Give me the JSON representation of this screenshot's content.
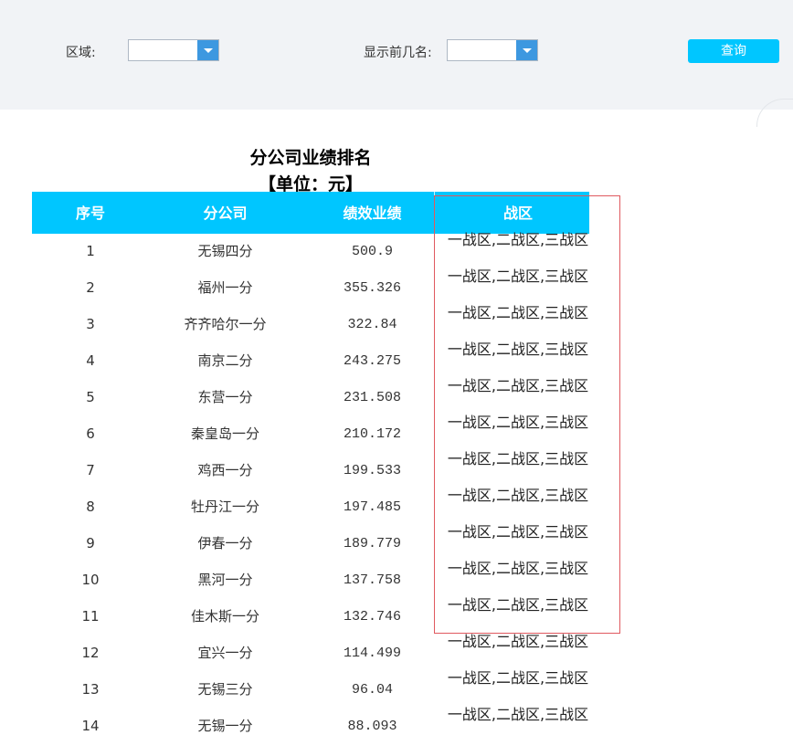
{
  "filters": {
    "region_label": "区域:",
    "region_value": "",
    "topn_label": "显示前几名:",
    "topn_value": "",
    "query_label": "查询"
  },
  "report": {
    "title": "分公司业绩排名",
    "unit": "【单位：元】",
    "columns": [
      "序号",
      "分公司",
      "绩效业绩",
      "战区"
    ],
    "rows": [
      {
        "idx": "1",
        "name": "无锡四分",
        "perf": "500.9",
        "zone": "一战区,二战区,三战区"
      },
      {
        "idx": "2",
        "name": "福州一分",
        "perf": "355.326",
        "zone": "一战区,二战区,三战区"
      },
      {
        "idx": "3",
        "name": "齐齐哈尔一分",
        "perf": "322.84",
        "zone": "一战区,二战区,三战区"
      },
      {
        "idx": "4",
        "name": "南京二分",
        "perf": "243.275",
        "zone": "一战区,二战区,三战区"
      },
      {
        "idx": "5",
        "name": "东营一分",
        "perf": "231.508",
        "zone": "一战区,二战区,三战区"
      },
      {
        "idx": "6",
        "name": "秦皇岛一分",
        "perf": "210.172",
        "zone": "一战区,二战区,三战区"
      },
      {
        "idx": "7",
        "name": "鸡西一分",
        "perf": "199.533",
        "zone": "一战区,二战区,三战区"
      },
      {
        "idx": "8",
        "name": "牡丹江一分",
        "perf": "197.485",
        "zone": "一战区,二战区,三战区"
      },
      {
        "idx": "9",
        "name": "伊春一分",
        "perf": "189.779",
        "zone": "一战区,二战区,三战区"
      },
      {
        "idx": "10",
        "name": "黑河一分",
        "perf": "137.758",
        "zone": "一战区,二战区,三战区"
      },
      {
        "idx": "11",
        "name": "佳木斯一分",
        "perf": "132.746",
        "zone": "一战区,二战区,三战区"
      },
      {
        "idx": "12",
        "name": "宜兴一分",
        "perf": "114.499",
        "zone": "一战区,二战区,三战区"
      },
      {
        "idx": "13",
        "name": "无锡三分",
        "perf": "96.04",
        "zone": "一战区,二战区,三战区"
      },
      {
        "idx": "14",
        "name": "无锡一分",
        "perf": "88.093",
        "zone": "一战区,二战区,三战区"
      }
    ]
  },
  "colors": {
    "header_bg": "#00c6ff",
    "highlight_border": "#e0595f",
    "filter_bg": "#f1f3f6",
    "combo_button": "#3d98e0"
  }
}
